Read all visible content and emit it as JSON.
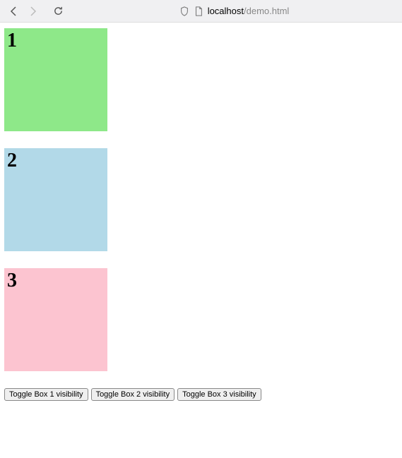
{
  "browser": {
    "url_host": "localhost",
    "url_path": "/demo.html"
  },
  "boxes": [
    {
      "label": "1",
      "color": "#8ee889"
    },
    {
      "label": "2",
      "color": "#b2d9e8"
    },
    {
      "label": "3",
      "color": "#fcc4d0"
    }
  ],
  "buttons": {
    "toggle1": "Toggle Box 1 visibility",
    "toggle2": "Toggle Box 2 visibility",
    "toggle3": "Toggle Box 3 visibility"
  }
}
